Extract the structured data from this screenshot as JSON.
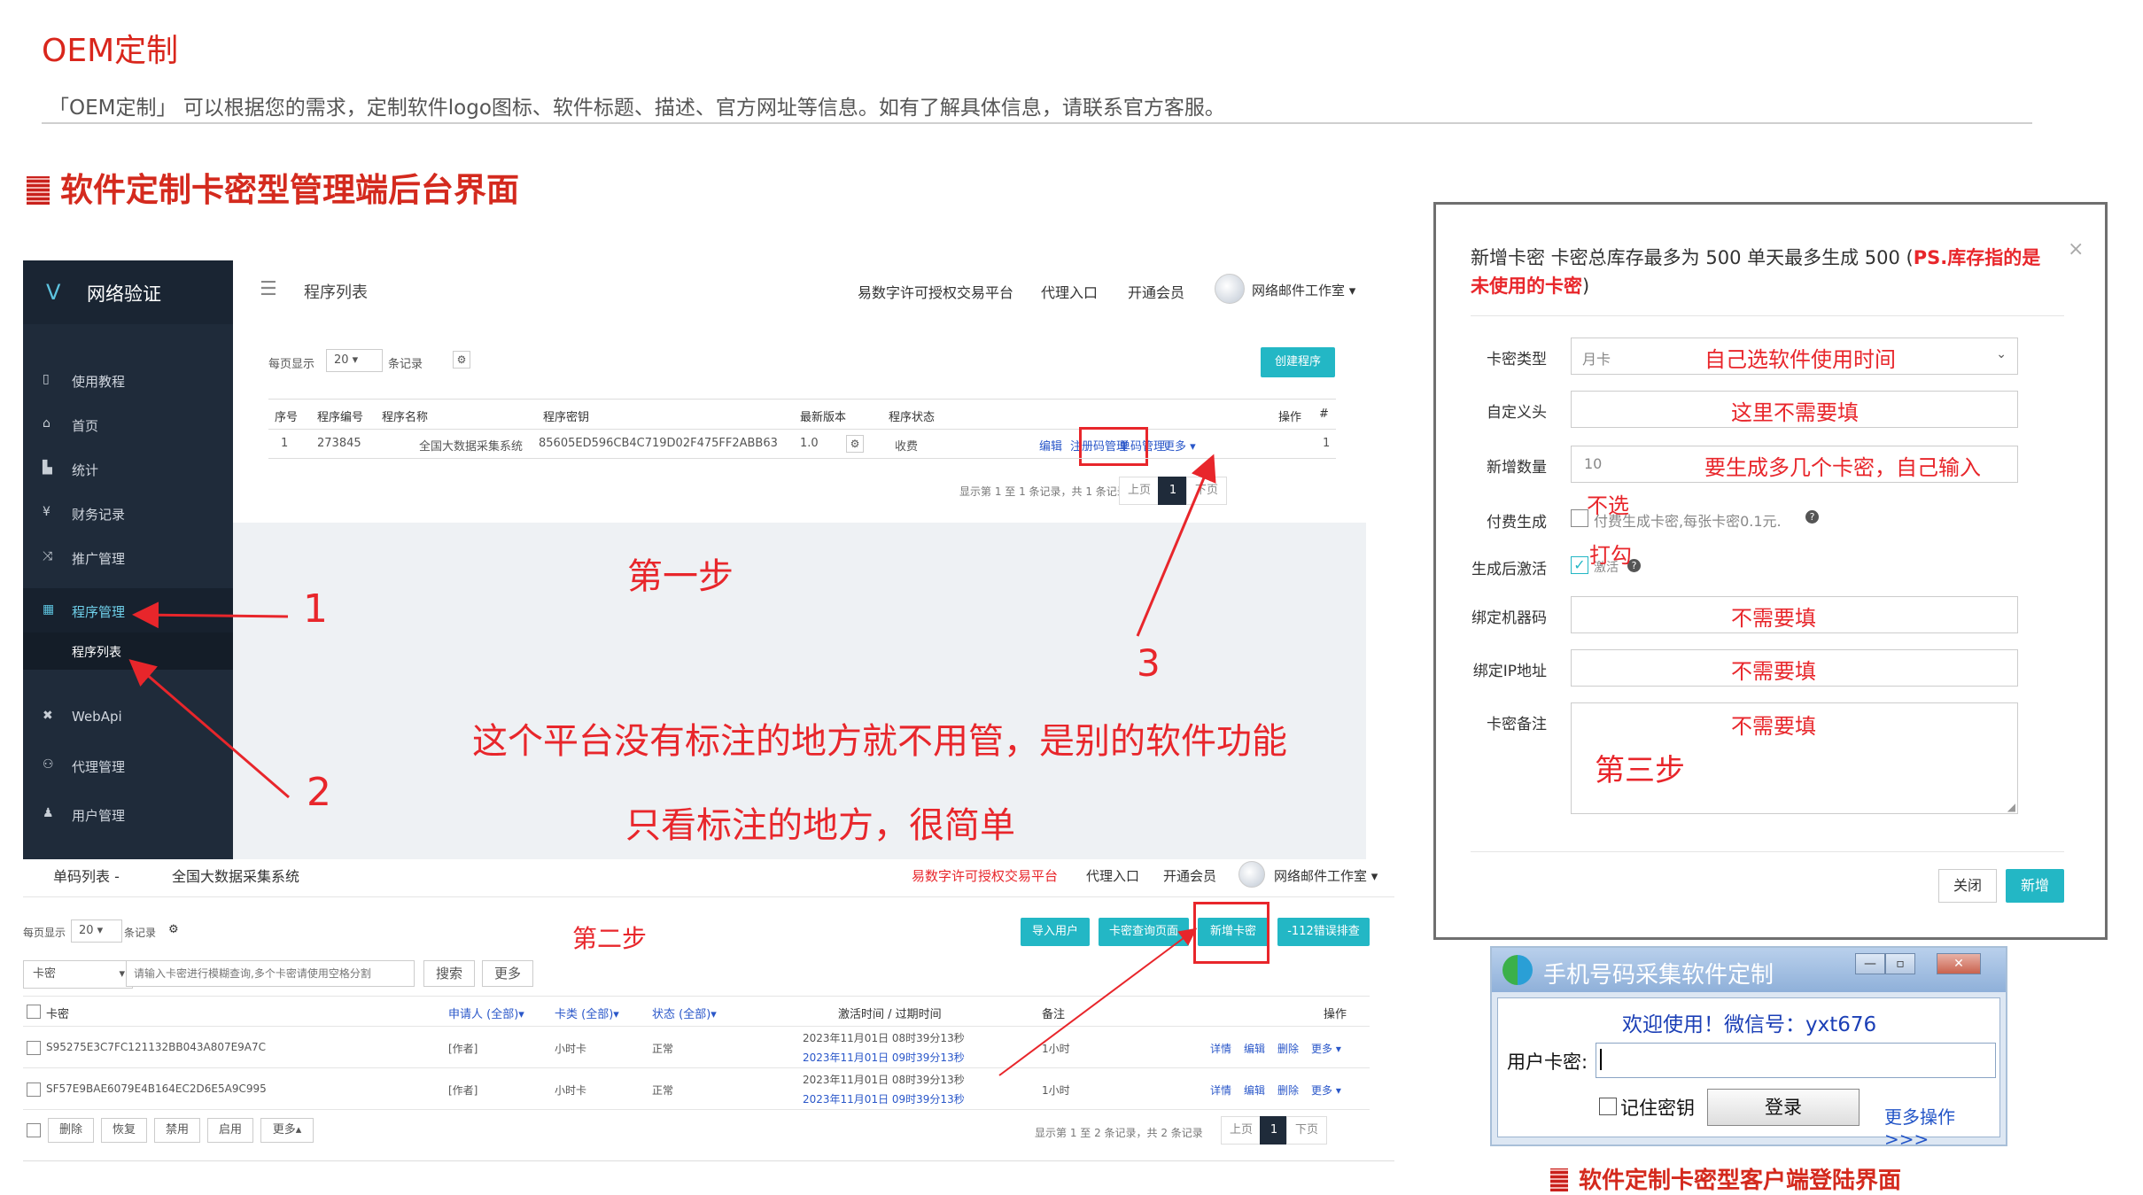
{
  "header": {
    "title": "OEM定制",
    "description": "「OEM定制」 可以根据您的需求，定制软件logo图标、软件标题、描述、官方网址等信息。如有了解具体信息，请联系官方客服。",
    "section_title": "软件定制卡密型管理端后台界面"
  },
  "admin": {
    "brand": "网络验证",
    "sidebar": {
      "items": [
        {
          "icon": "book-icon",
          "label": "使用教程"
        },
        {
          "icon": "home-icon",
          "label": "首页"
        },
        {
          "icon": "bar-chart-icon",
          "label": "统计"
        },
        {
          "icon": "yen-icon",
          "label": "财务记录"
        },
        {
          "icon": "shuffle-icon",
          "label": "推广管理"
        },
        {
          "icon": "windows-icon",
          "label": "程序管理"
        },
        {
          "icon": "plugin-icon",
          "label": "WebApi"
        },
        {
          "icon": "users-icon",
          "label": "代理管理"
        },
        {
          "icon": "user-icon",
          "label": "用户管理"
        }
      ],
      "sub_item": "程序列表"
    },
    "topbar": {
      "page_title": "程序列表",
      "nav_promo": "易数字许可授权交易平台",
      "nav_agent": "代理入口",
      "nav_member": "开通会员",
      "user": "网络邮件工作室"
    },
    "list": {
      "per_page_label": "每页显示",
      "per_page_value": "20",
      "per_page_unit": "条记录",
      "create_button": "创建程序",
      "columns": [
        "序号",
        "程序编号",
        "程序名称",
        "程序密钥",
        "最新版本",
        "程序状态",
        "操作",
        "#"
      ],
      "row": {
        "index": "1",
        "id": "273845",
        "name": "全国大数据采集系统",
        "key": "85605ED596CB4C719D02F475FF2ABB63",
        "version": "1.0",
        "status": "收费",
        "actions": [
          "编辑",
          "注册码管理",
          "单码管理",
          "更多"
        ],
        "hash": "1"
      },
      "summary": "显示第 1 至 1 条记录，共 1 条记录",
      "prev": "上页",
      "page": "1",
      "next": "下页"
    },
    "annotations": {
      "step1": "第一步",
      "num1": "1",
      "num2": "2",
      "num3": "3",
      "note1": "这个平台没有标注的地方就不用管，是别的软件功能",
      "note2": "只看标注的地方，很简单"
    }
  },
  "cards": {
    "breadcrumb": "单码列表 -",
    "program": "全国大数据采集系统",
    "nav_promo": "易数字许可授权交易平台",
    "nav_agent": "代理入口",
    "nav_member": "开通会员",
    "user": "网络邮件工作室",
    "per_page_label": "每页显示",
    "per_page_value": "20",
    "per_page_unit": "条记录",
    "step2": "第二步",
    "buttons": [
      "导入用户",
      "卡密查询页面",
      "新增卡密",
      "-112错误排查"
    ],
    "filter_type": "卡密",
    "search_placeholder": "请输入卡密进行模糊查询,多个卡密请使用空格分割",
    "search_button": "搜索",
    "more_button": "更多",
    "columns": [
      "卡密",
      "申请人 (全部)",
      "卡类 (全部)",
      "状态 (全部)",
      "激活时间 / 过期时间",
      "备注",
      "操作"
    ],
    "rows": [
      {
        "key": "S95275E3C7FC121132BB043A807E9A7C",
        "applicant": "[作者]",
        "type": "小时卡",
        "status": "正常",
        "activated": "2023年11月01日 08时39分13秒",
        "expires": "2023年11月01日 09时39分13秒",
        "note": "1小时",
        "actions": [
          "详情",
          "编辑",
          "删除",
          "更多"
        ]
      },
      {
        "key": "SF57E9BAE6079E4B164EC2D6E5A9C995",
        "applicant": "[作者]",
        "type": "小时卡",
        "status": "正常",
        "activated": "2023年11月01日 08时39分13秒",
        "expires": "2023年11月01日 09时39分13秒",
        "note": "1小时",
        "actions": [
          "详情",
          "编辑",
          "删除",
          "更多"
        ]
      }
    ],
    "bulk_actions": [
      "删除",
      "恢复",
      "禁用",
      "启用",
      "更多"
    ],
    "summary": "显示第 1 至 2 条记录，共 2 条记录",
    "prev": "上页",
    "page": "1",
    "next": "下页"
  },
  "modal": {
    "title_plain": "新增卡密 卡密总库存最多为 500 单天最多生成 500 (",
    "title_red": "PS.库存指的是未使用的卡密",
    "title_end": ")",
    "close": "×",
    "fields": {
      "type_label": "卡密类型",
      "type_value": "月卡",
      "type_note": "自己选软件使用时间",
      "prefix_label": "自定义头",
      "prefix_note": "这里不需要填",
      "qty_label": "新增数量",
      "qty_value": "10",
      "qty_note": "要生成多几个卡密，自己输入",
      "pay_label": "付费生成",
      "pay_note": "不选",
      "pay_text": "付费生成卡密,每张卡密0.1元.",
      "activate_label": "生成后激活",
      "activate_note": "打勾",
      "activate_text": "激活",
      "machine_label": "绑定机器码",
      "machine_note": "不需要填",
      "ip_label": "绑定IP地址",
      "ip_note": "不需要填",
      "remark_label": "卡密备注",
      "remark_note": "不需要填",
      "step3": "第三步"
    },
    "cancel_button": "关闭",
    "submit_button": "新增"
  },
  "login": {
    "title": "手机号码采集软件定制",
    "welcome": "欢迎使用！微信号：yxt676",
    "label": "用户卡密:",
    "remember": "记住密钥",
    "login_button": "登录",
    "more": "更多操作>>>",
    "caption": "软件定制卡密型客户端登陆界面"
  }
}
